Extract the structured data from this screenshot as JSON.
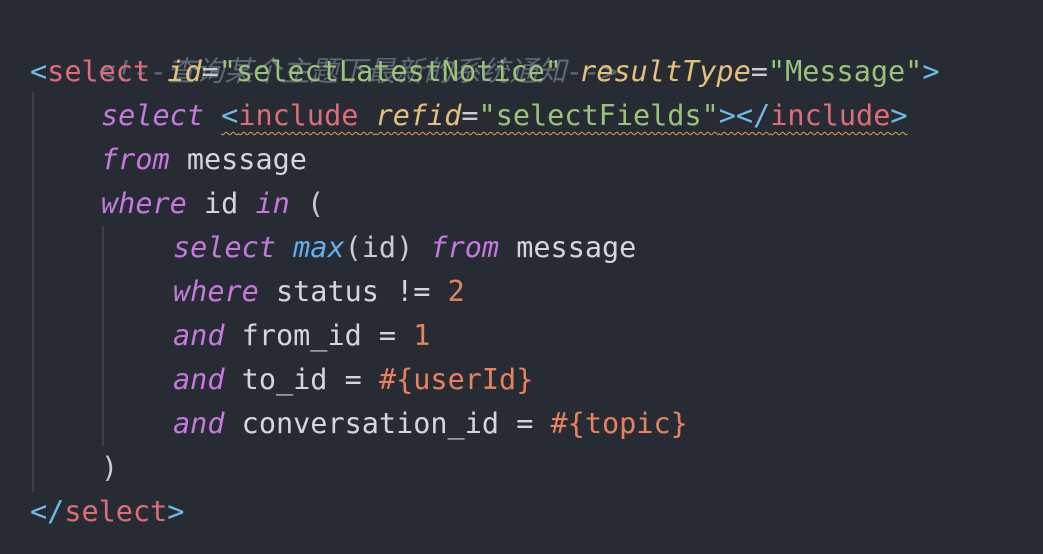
{
  "editor": {
    "comment": "<!--查询某个主题下最新的系统通知-->",
    "open_tag": {
      "lt": "<",
      "name": "select",
      "id_attr": "id",
      "id_value": "\"selectLatestNotice\"",
      "type_attr": "resultType",
      "type_value": "\"Message\"",
      "gt": ">",
      "eq": "="
    },
    "line2": {
      "kw": "select",
      "lt": "<",
      "tag": "include",
      "attr": "refid",
      "eq": "=",
      "value": "\"selectFields\"",
      "close": "></",
      "end_tag": "include",
      "gt": ">"
    },
    "line3": {
      "kw": "from",
      "table": "message"
    },
    "line4": {
      "kw": "where",
      "col": "id",
      "op": "in",
      "paren": "("
    },
    "line5": {
      "kw1": "select",
      "fn": "max",
      "args": "(id)",
      "kw2": "from",
      "table": "message"
    },
    "line6": {
      "kw": "where",
      "expr": "status != ",
      "num": "2"
    },
    "line7": {
      "kw": "and",
      "expr": "from_id = ",
      "num": "1"
    },
    "line8": {
      "kw": "and",
      "expr": "to_id = ",
      "val": "#{userId}"
    },
    "line9": {
      "kw": "and",
      "expr": "conversation_id = ",
      "val": "#{topic}"
    },
    "line10": {
      "paren": ")"
    },
    "close_tag": {
      "open": "</",
      "name": "select",
      "gt": ">"
    }
  }
}
